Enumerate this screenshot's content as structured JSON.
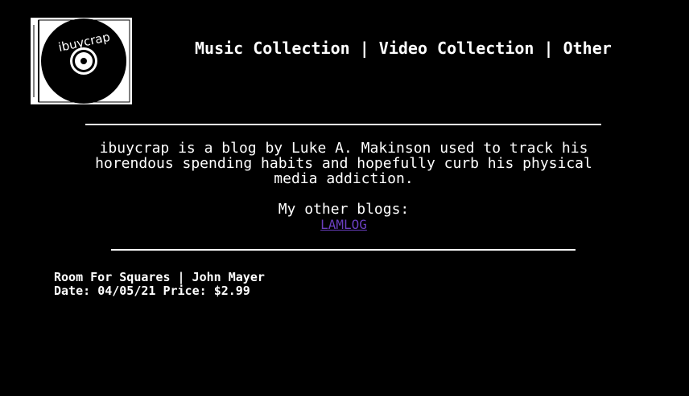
{
  "logo": {
    "text": "ibuycrap",
    "icon": "cd-case-logo"
  },
  "nav": {
    "items": [
      "Music Collection",
      "Video Collection",
      "Other"
    ],
    "separator": "|"
  },
  "about": {
    "lines": [
      "ibuycrap is a blog by Luke A. Makinson used to track his",
      "horendous spending habits and hopefully curb his physical",
      "media addiction."
    ]
  },
  "other_blogs": {
    "label": "My other blogs:",
    "link": "LAMLOG"
  },
  "entries": [
    {
      "title_line": "Room For Squares | John Mayer",
      "date_label": "Date:",
      "date": "04/05/21",
      "price_label": "Price:",
      "price": "$2.99"
    }
  ],
  "colors": {
    "background": "#000000",
    "text": "#ffffff",
    "link": "#6a3fbf"
  }
}
